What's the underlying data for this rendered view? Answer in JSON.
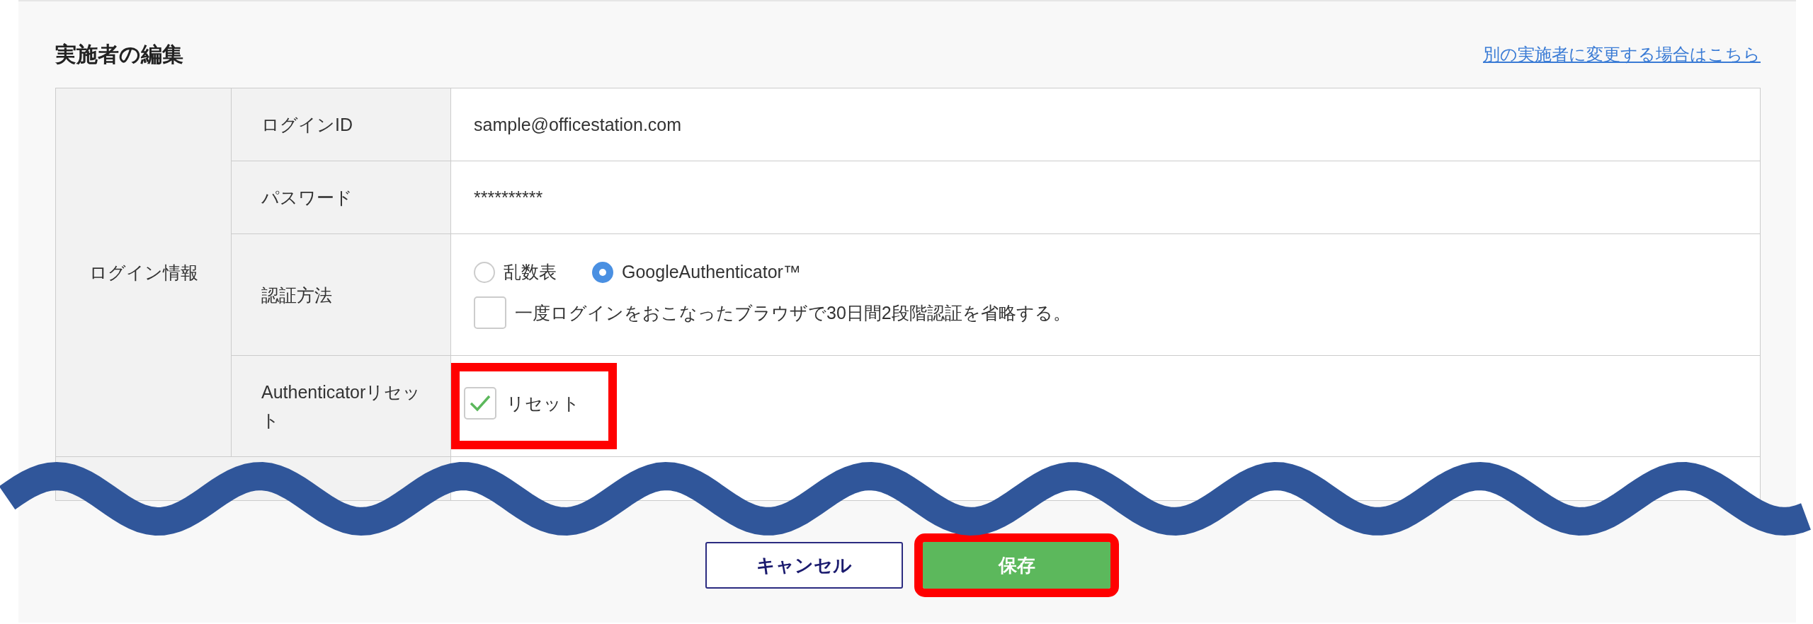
{
  "title": "実施者の編集",
  "link": "別の実施者に変更する場合はこちら",
  "table": {
    "group_label": "ログイン情報",
    "rows": [
      {
        "kind": "text",
        "label": "ログインID",
        "value": "sample@officestation.com"
      },
      {
        "kind": "text",
        "label": "パスワード",
        "value": "**********"
      },
      {
        "kind": "auth",
        "label": "認証方法",
        "options": [
          {
            "label": "乱数表",
            "selected": false
          },
          {
            "label": "GoogleAuthenticator™",
            "selected": true
          }
        ],
        "skip": {
          "label": "一度ログインをおこなったブラウザで30日間2段階認証を省略する。",
          "checked": false
        }
      },
      {
        "kind": "checkbox",
        "label": "Authenticatorリセット",
        "check": {
          "label": "リセット",
          "checked": true
        },
        "highlighted": true
      }
    ]
  },
  "buttons": [
    {
      "kind": "secondary",
      "label": "キャンセル",
      "highlighted": false
    },
    {
      "kind": "primary",
      "label": "保存",
      "highlighted": true
    }
  ]
}
